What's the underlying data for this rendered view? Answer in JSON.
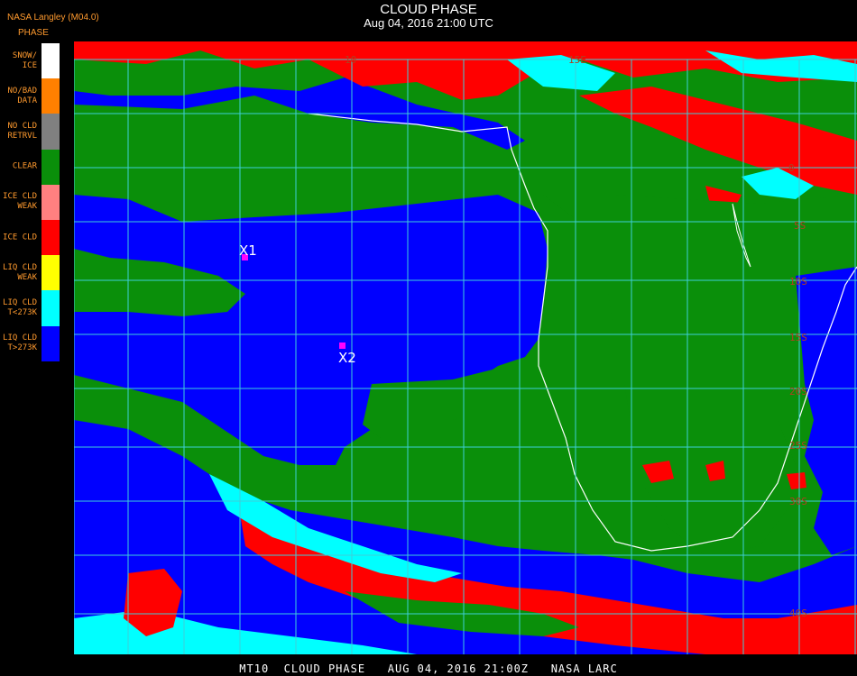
{
  "header": {
    "organization": "NASA Langley (M04.0)",
    "legend_title": "PHASE",
    "title": "CLOUD PHASE",
    "subtitle": "Aug 04, 2016 21:00 UTC"
  },
  "legend": [
    {
      "label": "SNOW/\nICE",
      "color": "#ffffff"
    },
    {
      "label": "NO/BAD\nDATA",
      "color": "#ff8000"
    },
    {
      "label": "NO CLD\nRETRVL",
      "color": "#808080"
    },
    {
      "label": "CLEAR",
      "color": "#0a8f0a"
    },
    {
      "label": "ICE CLD\nWEAK",
      "color": "#ff8080"
    },
    {
      "label": "ICE CLD",
      "color": "#ff0000"
    },
    {
      "label": "LIQ CLD\nWEAK",
      "color": "#ffff00"
    },
    {
      "label": "LIQ CLD\nT<273K",
      "color": "#00ffff"
    },
    {
      "label": "LIQ CLD\nT>273K",
      "color": "#0000ff"
    }
  ],
  "map": {
    "grid_color": "#3ecfd8",
    "coastline_color": "#ffffff",
    "lon_labels": [
      "10",
      "15E"
    ],
    "lat_labels": [
      "0",
      "5S",
      "10S",
      "15S",
      "20S",
      "25S",
      "30S",
      "40S"
    ],
    "markers": [
      {
        "label": "X1",
        "color": "#ff00ff"
      },
      {
        "label": "X2",
        "color": "#ff00ff"
      }
    ]
  },
  "footer": "MT10  CLOUD PHASE   AUG 04, 2016 21:00Z   NASA LARC"
}
